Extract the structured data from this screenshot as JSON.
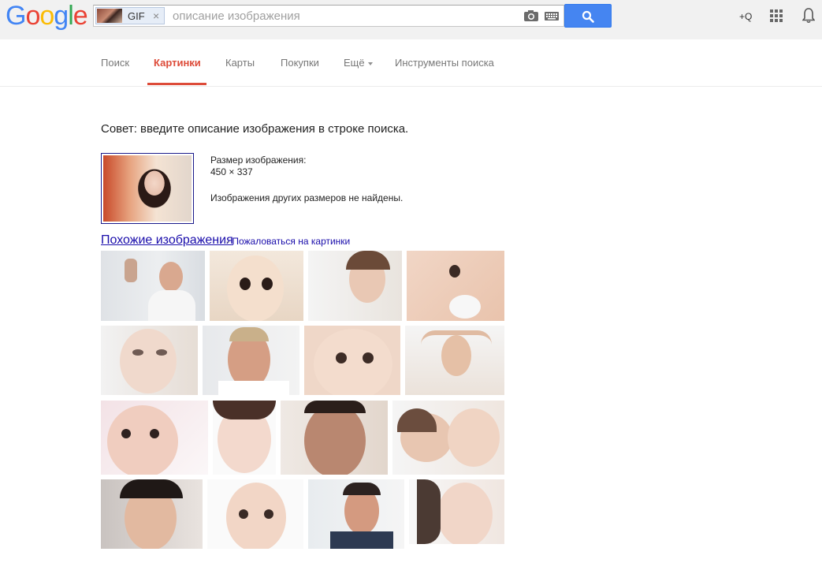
{
  "logo": {
    "letters": [
      "G",
      "o",
      "o",
      "g",
      "l",
      "e"
    ],
    "colors": [
      "#4285f4",
      "#ea4335",
      "#fbbc05",
      "#4285f4",
      "#34a853",
      "#ea4335"
    ]
  },
  "search": {
    "chip_label": "GIF",
    "chip_close": "×",
    "placeholder": "описание изображения",
    "value": "",
    "icons": [
      "camera-icon",
      "keyboard-icon",
      "search-icon"
    ]
  },
  "header": {
    "plus_label": "+Q",
    "icons": [
      "apps-grid-icon",
      "notifications-bell-icon"
    ]
  },
  "nav": {
    "tabs": [
      {
        "label": "Поиск",
        "active": false
      },
      {
        "label": "Картинки",
        "active": true
      },
      {
        "label": "Карты",
        "active": false
      },
      {
        "label": "Покупки",
        "active": false
      },
      {
        "label": "Ещё",
        "active": false,
        "dropdown": true
      },
      {
        "label": "Инструменты поиска",
        "active": false
      }
    ]
  },
  "main": {
    "tip": "Совет: введите описание изображения в строке поиска.",
    "image_size_label": "Размер изображения:",
    "image_size_value": "450 × 337",
    "no_other_sizes": "Изображения других размеров не найдены.",
    "similar_link": "Похожие изображения",
    "report_dash": " - ",
    "report_link": "Пожаловаться на картинки"
  },
  "colors": {
    "accent_red": "#dd4b39",
    "link_blue": "#1a0dab",
    "search_button": "#4585f1"
  }
}
